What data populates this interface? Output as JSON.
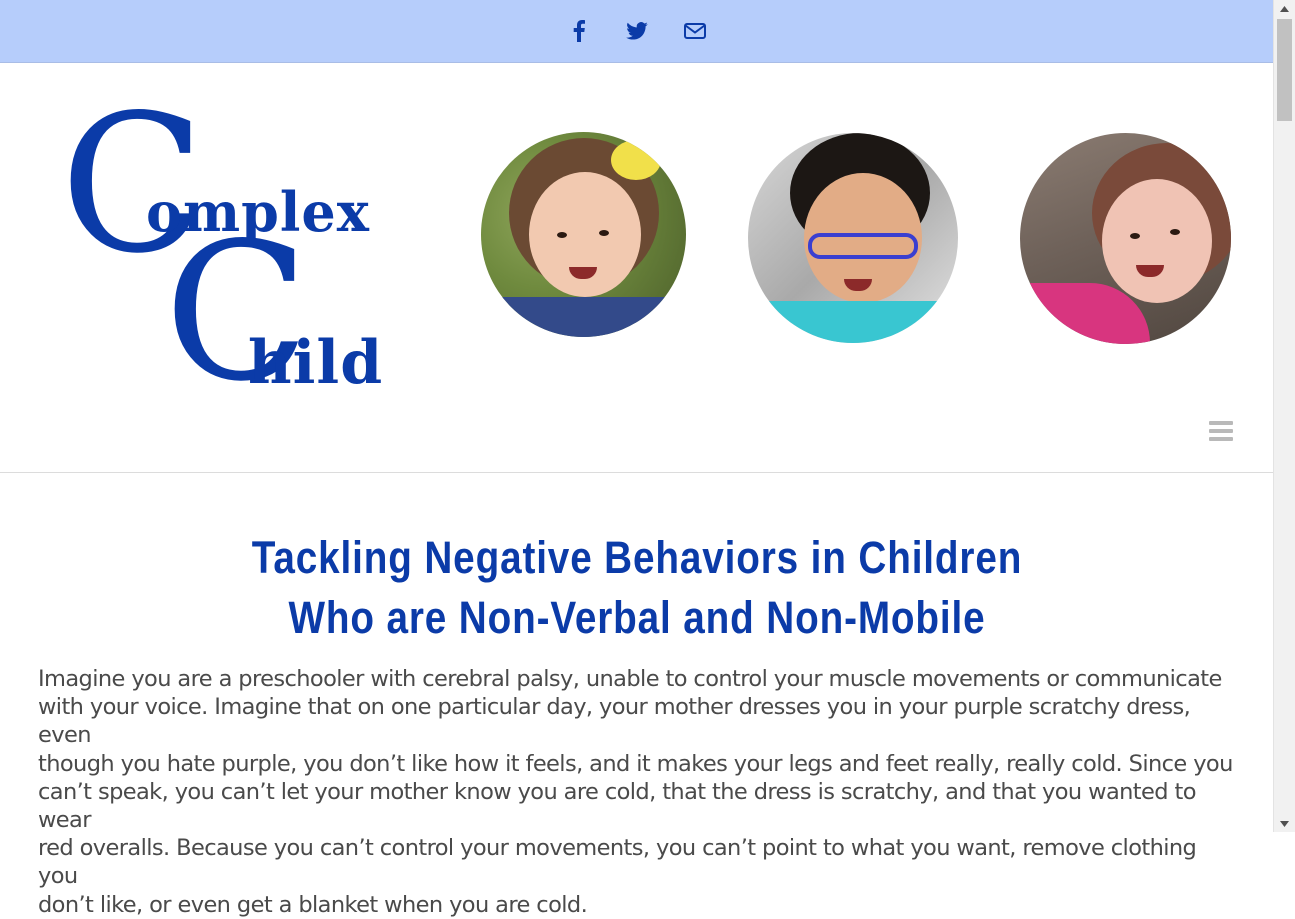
{
  "top_bar": {
    "icons": [
      "facebook-icon",
      "twitter-icon",
      "email-icon"
    ],
    "background": "#b6cdfb",
    "icon_color": "#0b3ba8"
  },
  "logo": {
    "line1_initial": "C",
    "line1_rest": "omplex",
    "line2_initial": "C",
    "line2_rest": "hild",
    "color": "#0b3ba8"
  },
  "header": {
    "menu_icon": "hamburger-menu-icon"
  },
  "article": {
    "title_line1": "Tackling Negative Behaviors in Children",
    "title_line2": "Who are Non-Verbal and Non-Mobile",
    "paragraph_lines": [
      "Imagine you are a preschooler with cerebral palsy, unable to control your muscle movements or communicate",
      "with your voice. Imagine that on one particular day, your mother dresses you in your purple scratchy dress, even",
      "though you hate purple, you don’t like how it feels, and it makes your legs and feet really, really cold. Since you",
      "can’t speak, you can’t let your mother know you are cold, that the dress is scratchy, and that you wanted to wear",
      "red overalls. Because you can’t control your movements, you can’t point to what you want, remove clothing you",
      "don’t like, or even get a blanket when you are cold."
    ]
  },
  "colors": {
    "accent": "#0b3ba8",
    "text": "#4a4a4a"
  }
}
